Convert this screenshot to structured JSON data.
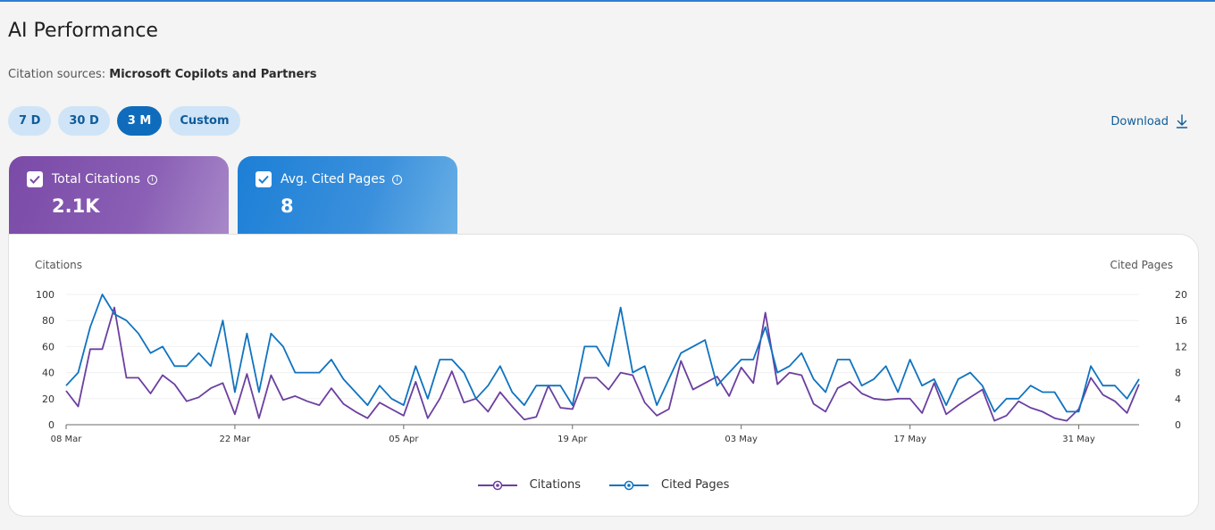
{
  "page": {
    "title": "AI Performance",
    "sources_label": "Citation sources:",
    "sources_value": "Microsoft Copilots and Partners",
    "download_label": "Download"
  },
  "ranges": [
    {
      "label": "7 D",
      "active": false
    },
    {
      "label": "30 D",
      "active": false
    },
    {
      "label": "3 M",
      "active": true
    },
    {
      "label": "Custom",
      "active": false
    }
  ],
  "tiles": [
    {
      "label": "Total Citations",
      "value": "2.1K",
      "checked": true
    },
    {
      "label": "Avg. Cited Pages",
      "value": "8",
      "checked": true
    }
  ],
  "colors": {
    "citations": "#6b3fa0",
    "cited_pages": "#0f73c0",
    "accent": "#0f6cbd"
  },
  "chart_data": {
    "type": "line",
    "left_axis_label": "Citations",
    "right_axis_label": "Cited Pages",
    "left_ylim": [
      0,
      100
    ],
    "right_ylim": [
      0,
      20
    ],
    "left_ticks": [
      "0",
      "20",
      "40",
      "60",
      "80",
      "100"
    ],
    "right_ticks": [
      "0",
      "4",
      "8",
      "12",
      "16",
      "20"
    ],
    "x_tick_labels": [
      "08 Mar",
      "22 Mar",
      "05 Apr",
      "19 Apr",
      "03 May",
      "17 May",
      "31 May"
    ],
    "x_start": "08 Mar",
    "legend_position": "bottom",
    "series": [
      {
        "name": "Citations",
        "axis": "left",
        "values": [
          26,
          14,
          58,
          58,
          90,
          36,
          36,
          24,
          38,
          31,
          18,
          21,
          28,
          32,
          8,
          39,
          5,
          38,
          19,
          22,
          18,
          15,
          28,
          16,
          10,
          5,
          17,
          12,
          7,
          33,
          5,
          20,
          41,
          17,
          20,
          10,
          25,
          14,
          4,
          6,
          30,
          13,
          12,
          36,
          36,
          27,
          40,
          38,
          17,
          7,
          12,
          49,
          27,
          32,
          37,
          22,
          44,
          32,
          86,
          31,
          40,
          38,
          16,
          10,
          28,
          33,
          24,
          20,
          19,
          20,
          20,
          9,
          32,
          8,
          15,
          21,
          27,
          3,
          7,
          18,
          13,
          10,
          5,
          3,
          12,
          36,
          23,
          18,
          9,
          31
        ]
      },
      {
        "name": "Cited Pages",
        "axis": "right",
        "values": [
          6,
          8,
          15,
          20,
          17,
          16,
          14,
          11,
          12,
          9,
          9,
          11,
          9,
          16,
          5,
          14,
          5,
          14,
          12,
          8,
          8,
          8,
          10,
          7,
          5,
          3,
          6,
          4,
          3,
          9,
          4,
          10,
          10,
          8,
          4,
          6,
          9,
          5,
          3,
          6,
          6,
          6,
          3,
          12,
          12,
          9,
          18,
          8,
          9,
          3,
          7,
          11,
          12,
          13,
          6,
          8,
          10,
          10,
          15,
          8,
          9,
          11,
          7,
          5,
          10,
          10,
          6,
          7,
          9,
          5,
          10,
          6,
          7,
          3,
          7,
          8,
          6,
          2,
          4,
          4,
          6,
          5,
          5,
          2,
          2,
          9,
          6,
          6,
          4,
          7
        ]
      }
    ]
  }
}
